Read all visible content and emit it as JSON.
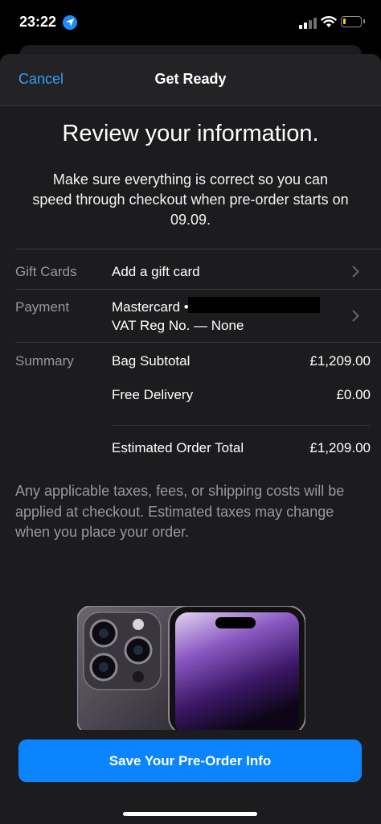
{
  "status": {
    "time": "23:22"
  },
  "nav": {
    "cancel": "Cancel",
    "title": "Get Ready"
  },
  "heading": "Review your information.",
  "subtext": "Make sure everything is correct so you can speed through checkout when pre-order starts on 09.09.",
  "gift_cards": {
    "label": "Gift Cards",
    "value": "Add a gift card"
  },
  "payment": {
    "label": "Payment",
    "card": "Mastercard •",
    "vat": "VAT Reg No. — None"
  },
  "summary": {
    "label": "Summary",
    "rows": [
      {
        "name": "Bag Subtotal",
        "amount": "£1,209.00"
      },
      {
        "name": "Free Delivery",
        "amount": "£0.00"
      }
    ],
    "total": {
      "name": "Estimated Order Total",
      "amount": "£1,209.00"
    }
  },
  "disclaimer": "Any applicable taxes, fees, or shipping costs will be applied at checkout. Estimated taxes may change when you place your order.",
  "cta": "Save Your Pre-Order Info"
}
